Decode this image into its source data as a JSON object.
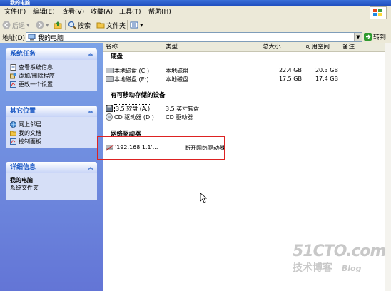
{
  "window": {
    "title": "我的电脑"
  },
  "menu": [
    "文件(F)",
    "编辑(E)",
    "查看(V)",
    "收藏(A)",
    "工具(T)",
    "帮助(H)"
  ],
  "toolbar": {
    "back": "后退",
    "search": "搜索",
    "folders": "文件夹"
  },
  "address": {
    "label": "地址(D)",
    "value": "我的电脑",
    "go": "转到"
  },
  "sidebar": {
    "system_tasks": {
      "title": "系统任务",
      "items": [
        "查看系统信息",
        "添加/删除程序",
        "更改一个设置"
      ]
    },
    "other_places": {
      "title": "其它位置",
      "items": [
        "网上邻居",
        "我的文档",
        "控制面板"
      ]
    },
    "details": {
      "title": "详细信息",
      "name": "我的电脑",
      "type": "系统文件夹"
    }
  },
  "columns": [
    "名称",
    "类型",
    "总大小",
    "可用空间",
    "备注"
  ],
  "groups": {
    "hard_disks": "硬盘",
    "removable": "有可移动存储的设备",
    "network": "网络驱动器"
  },
  "drives": [
    {
      "name": "本地磁盘 (C:)",
      "type": "本地磁盘",
      "total": "22.4 GB",
      "free": "20.3 GB"
    },
    {
      "name": "本地磁盘 (E:)",
      "type": "本地磁盘",
      "total": "17.5 GB",
      "free": "17.4 GB"
    }
  ],
  "removable": [
    {
      "name": "3.5 软盘 (A:)",
      "type": "3.5 英寸软盘"
    },
    {
      "name": "CD 驱动器 (D:)",
      "type": "CD 驱动器"
    }
  ],
  "network": [
    {
      "name": "'192.168.1.1'...",
      "type": "断开网络驱动器"
    }
  ],
  "watermark": {
    "line1": "51CTO.com",
    "line2": "技术博客",
    "line3": "Blog"
  }
}
